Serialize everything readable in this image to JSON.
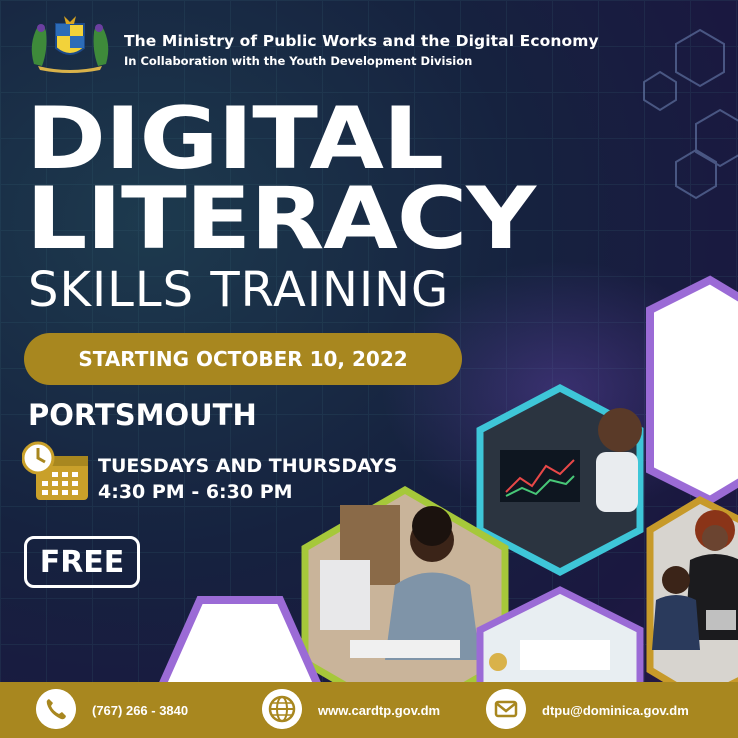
{
  "header": {
    "ministry": "The Ministry of Public Works and the Digital Economy",
    "collaboration": "In Collaboration with the Youth Development Division"
  },
  "title": {
    "line1": "DIGITAL",
    "line2": "LITERACY",
    "line3": "SKILLS TRAINING"
  },
  "start_date": "STARTING OCTOBER 10, 2022",
  "location": "PORTSMOUTH",
  "schedule": {
    "days": "TUESDAYS AND THURSDAYS",
    "time": "4:30 PM - 6:30 PM"
  },
  "price_badge": "FREE",
  "footer": {
    "phone": "(767) 266 - 3840",
    "website": "www.cardtp.gov.dm",
    "email": "dtpu@dominica.gov.dm"
  },
  "colors": {
    "gold": "#a8871f",
    "purple_border": "#9b6bd6",
    "cyan_border": "#3ec6d8",
    "green_border": "#a6c83a",
    "gold_border": "#c79a2a"
  },
  "icons": [
    "coat-of-arms-icon",
    "calendar-clock-icon",
    "phone-icon",
    "globe-icon",
    "mail-icon"
  ]
}
